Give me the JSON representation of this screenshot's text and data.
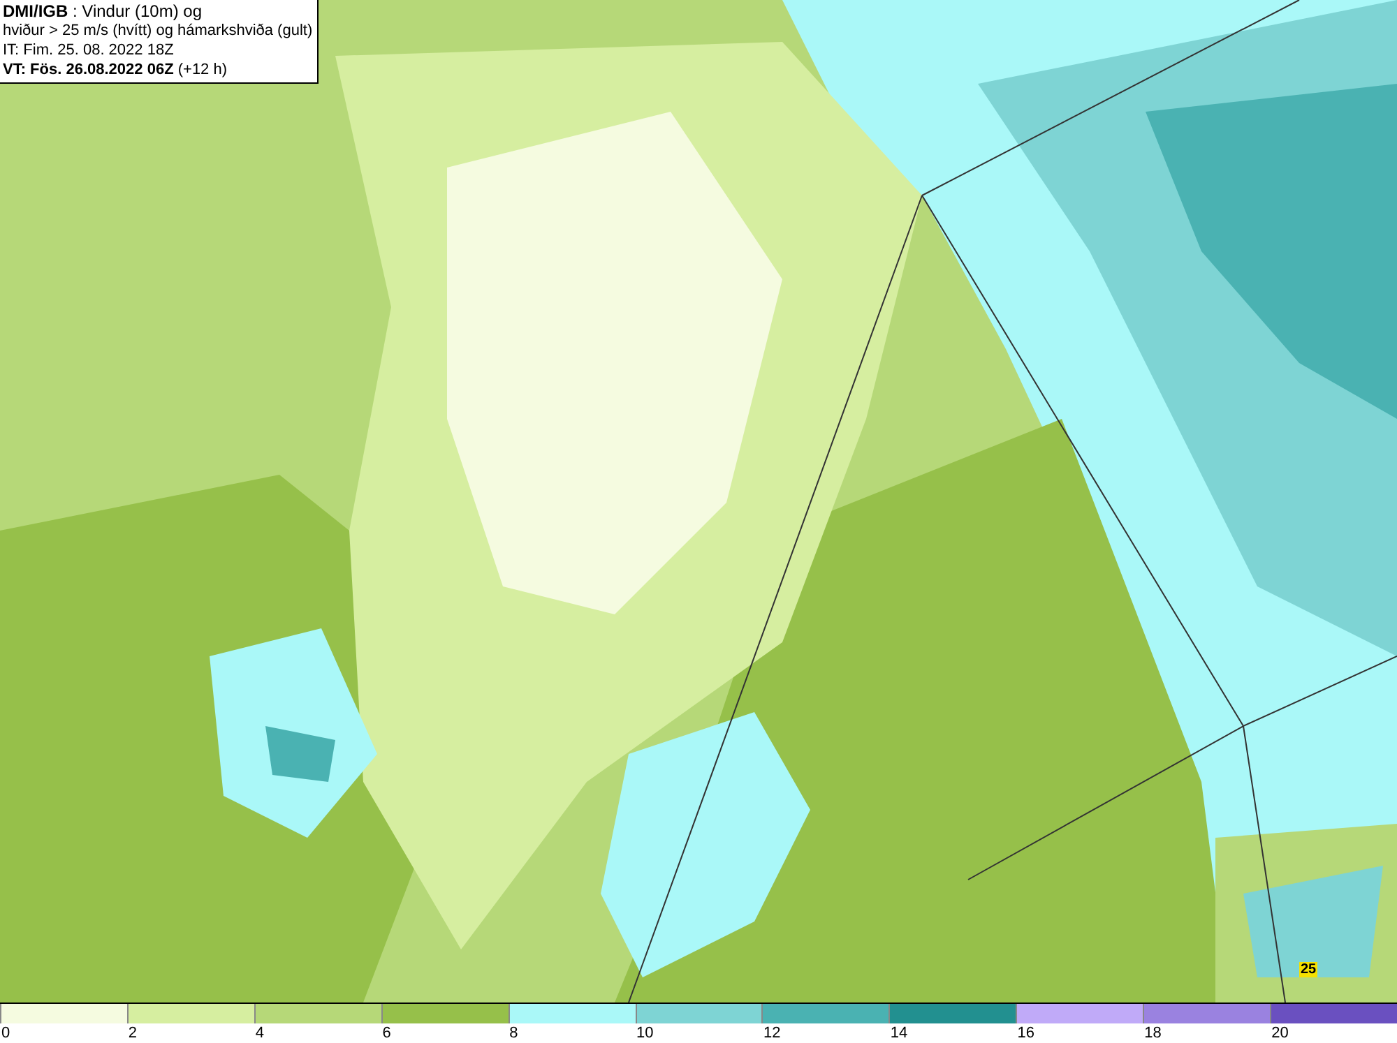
{
  "header": {
    "lines": [
      "**DMI/IGB** : Vindur (10m) og",
      "hviður > 25 m/s (hvítt) og hámarkshviða (gult)",
      "IT: Fim. 25. 08. 2022 18Z",
      "**VT: Fös. 26.08.2022 06Z** (+12 h)"
    ]
  },
  "map": {
    "gust_labels": [
      {
        "text": "25"
      }
    ]
  },
  "legend": {
    "items": [
      {
        "color": "#f5fbe0",
        "label": "0"
      },
      {
        "color": "#d6eea0",
        "label": "2"
      },
      {
        "color": "#b6d878",
        "label": "4"
      },
      {
        "color": "#96c04a",
        "label": "6"
      },
      {
        "color": "#aaf8f8",
        "label": "8"
      },
      {
        "color": "#7ed4d4",
        "label": "10"
      },
      {
        "color": "#4ab2b2",
        "label": "12"
      },
      {
        "color": "#229090",
        "label": "14"
      },
      {
        "color": "#c0aaf8",
        "label": "16"
      },
      {
        "color": "#9a82e0",
        "label": "18"
      },
      {
        "color": "#6a50c0",
        "label": "20"
      }
    ]
  }
}
